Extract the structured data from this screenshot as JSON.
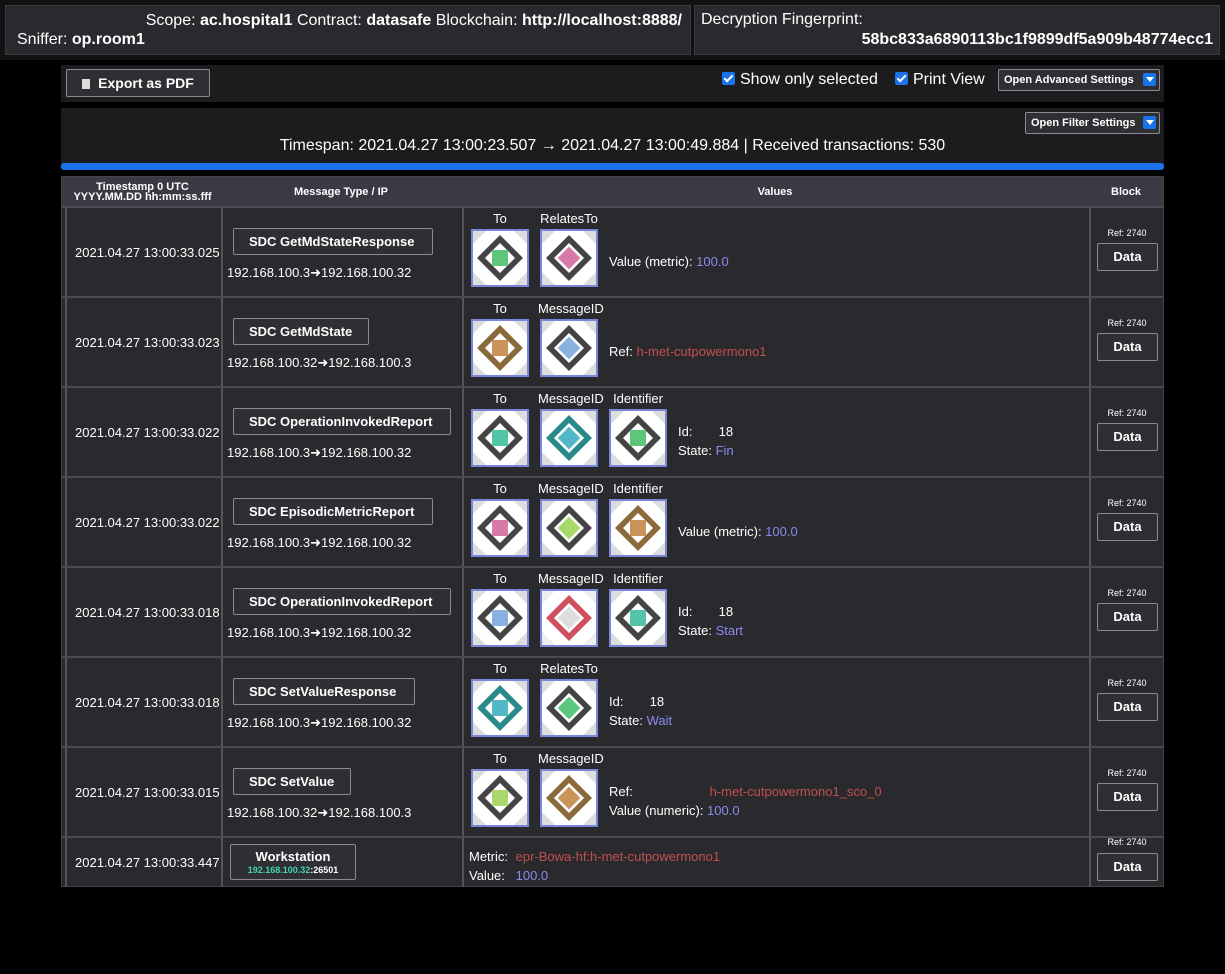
{
  "header": {
    "scope_label": "Scope:",
    "scope_value": "ac.hospital1",
    "contract_label": "Contract:",
    "contract_value": "datasafe",
    "blockchain_label": "Blockchain:",
    "blockchain_value": "http://localhost:8888/",
    "sniffer_label": "Sniffer:",
    "sniffer_value": "op.room1",
    "fingerprint_label": "Decryption Fingerprint:",
    "fingerprint_value": "58bc833a6890113bc1f9899df5a909b48774ecc1"
  },
  "toolbar": {
    "export_label": "Export as PDF",
    "show_selected_label": "Show only selected",
    "print_view_label": "Print View",
    "advanced_label": "Open Advanced Settings"
  },
  "filter": {
    "filter_label": "Open Filter Settings",
    "timespan": "Timespan: 2021.04.27 13:00:23.507 → 2021.04.27 13:00:49.884 | Received transactions: 530"
  },
  "table": {
    "headers": {
      "timestamp_line1": "Timestamp 0 UTC",
      "timestamp_line2": "YYYY.MM.DD hh:mm:ss.fff",
      "msgtype": "Message Type / IP",
      "values": "Values",
      "block": "Block"
    },
    "rows": [
      {
        "ts": "2021.04.27 13:00:33.025",
        "type": "SDC GetMdStateResponse",
        "ip": "192.168.100.3➜192.168.100.32",
        "icons": [
          "To",
          "RelatesTo"
        ],
        "v1_label": "Value (metric):",
        "v1_value": "100.0",
        "ref": "Ref: 2740",
        "data": "Data"
      },
      {
        "ts": "2021.04.27 13:00:33.023",
        "type": "SDC GetMdState",
        "ip": "192.168.100.32➜192.168.100.3",
        "icons": [
          "To",
          "MessageID"
        ],
        "v1_label": "Ref:",
        "v1_value": "h-met-cutpowermono1",
        "ref": "Ref: 2740",
        "data": "Data"
      },
      {
        "ts": "2021.04.27 13:00:33.022",
        "type": "SDC OperationInvokedReport",
        "ip": "192.168.100.3➜192.168.100.32",
        "icons": [
          "To",
          "MessageID",
          "Identifier"
        ],
        "v1_label": "Id:",
        "v1_value": "18",
        "v2_label": "State:",
        "v2_value": "Fin",
        "ref": "Ref: 2740",
        "data": "Data"
      },
      {
        "ts": "2021.04.27 13:00:33.022",
        "type": "SDC EpisodicMetricReport",
        "ip": "192.168.100.3➜192.168.100.32",
        "icons": [
          "To",
          "MessageID",
          "Identifier"
        ],
        "v1_label": "Value (metric):",
        "v1_value": "100.0",
        "ref": "Ref: 2740",
        "data": "Data"
      },
      {
        "ts": "2021.04.27 13:00:33.018",
        "type": "SDC OperationInvokedReport",
        "ip": "192.168.100.3➜192.168.100.32",
        "icons": [
          "To",
          "MessageID",
          "Identifier"
        ],
        "v1_label": "Id:",
        "v1_value": "18",
        "v2_label": "State:",
        "v2_value": "Start",
        "ref": "Ref: 2740",
        "data": "Data"
      },
      {
        "ts": "2021.04.27 13:00:33.018",
        "type": "SDC SetValueResponse",
        "ip": "192.168.100.3➜192.168.100.32",
        "icons": [
          "To",
          "RelatesTo"
        ],
        "v1_label": "Id:",
        "v1_value": "18",
        "v2_label": "State:",
        "v2_value": "Wait",
        "ref": "Ref: 2740",
        "data": "Data"
      },
      {
        "ts": "2021.04.27 13:00:33.015",
        "type": "SDC SetValue",
        "ip": "192.168.100.32➜192.168.100.3",
        "icons": [
          "To",
          "MessageID"
        ],
        "v1_label": "Ref:",
        "v1_value": "h-met-cutpowermono1_sco_0",
        "v2_label": "Value (numeric):",
        "v2_value": "100.0",
        "ref": "Ref: 2740",
        "data": "Data"
      },
      {
        "ts": "2021.04.27 13:00:33.447",
        "type": "Workstation",
        "ip_address": "192.168.100.32",
        "ip_port": ":26501",
        "v1_label": "Metric:",
        "v1_value": "epr-Bowa-hf:h-met-cutpowermono1",
        "v2_label": "Value:",
        "v2_value": "100.0",
        "ref": "Ref: 2740",
        "data": "Data"
      }
    ]
  },
  "colors": {
    "accent": "#1a73e8",
    "number_value": "#8a8af0",
    "string_value": "#c0504d",
    "ip_highlight": "#3fd6b4"
  }
}
